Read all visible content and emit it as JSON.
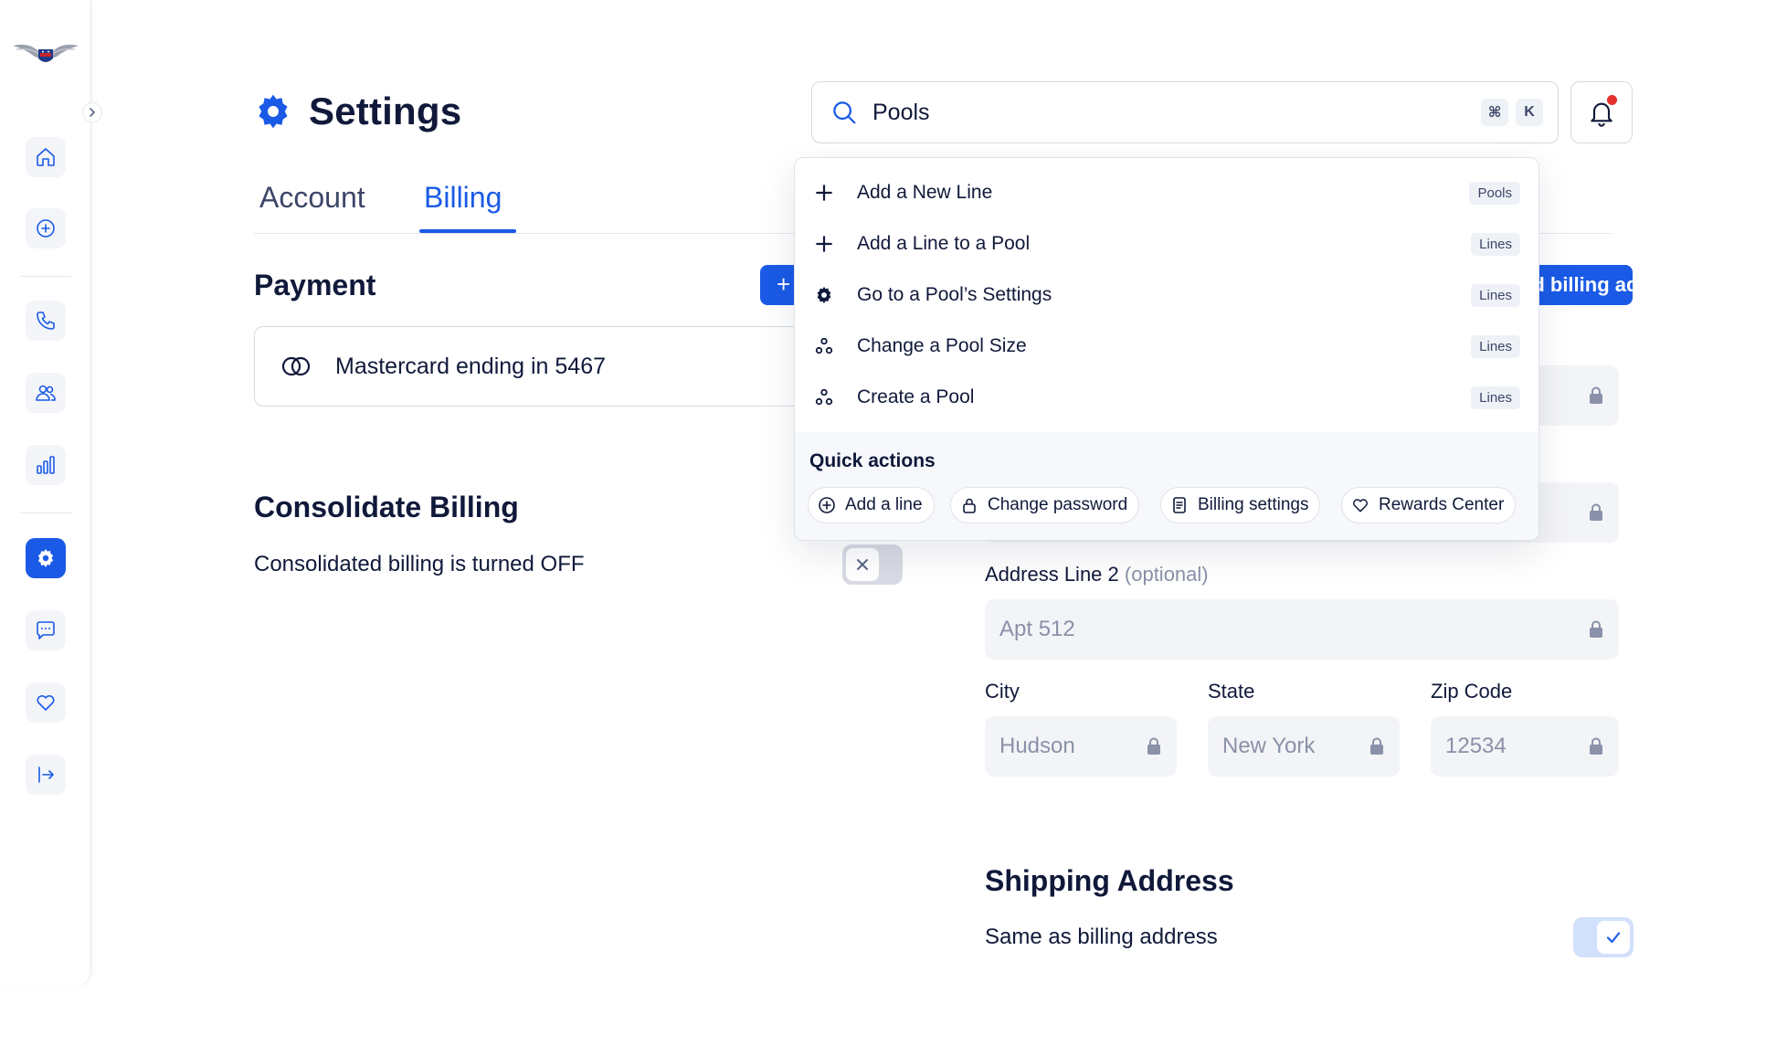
{
  "page": {
    "title": "Settings"
  },
  "search": {
    "value": "Pools",
    "kbd_cmd": "⌘",
    "kbd_key": "K"
  },
  "tabs": {
    "account": "Account",
    "billing": "Billing"
  },
  "payment": {
    "title": "Payment",
    "add_button": "+",
    "card_text": "Mastercard ending in 5467"
  },
  "consolidate": {
    "title": "Consolidate Billing",
    "text": "Consolidated billing is turned OFF"
  },
  "billing_address": {
    "add_button": "Add billing address",
    "address_line_2_label": "Address Line 2",
    "address_line_2_optional": "(optional)",
    "address_line_2_value": "Apt 512",
    "city_label": "City",
    "city_value": "Hudson",
    "state_label": "State",
    "state_value": "New York",
    "zip_label": "Zip Code",
    "zip_value": "12534"
  },
  "shipping": {
    "title": "Shipping Address",
    "text": "Same as billing address"
  },
  "dropdown": {
    "items": [
      {
        "label": "Add a New Line",
        "tag": "Pools",
        "icon": "plus-icon"
      },
      {
        "label": "Add a Line to a Pool",
        "tag": "Lines",
        "icon": "plus-icon"
      },
      {
        "label": "Go to a Pool’s Settings",
        "tag": "Lines",
        "icon": "gear-icon"
      },
      {
        "label": "Change a Pool Size",
        "tag": "Lines",
        "icon": "pool-icon"
      },
      {
        "label": "Create a Pool",
        "tag": "Lines",
        "icon": "pool-icon"
      }
    ],
    "quick_actions_title": "Quick actions",
    "quick_actions": [
      {
        "label": "Add a line",
        "icon": "plus-circle-icon"
      },
      {
        "label": "Change password",
        "icon": "lock-icon"
      },
      {
        "label": "Billing settings",
        "icon": "document-icon"
      },
      {
        "label": "Rewards Center",
        "icon": "heart-icon"
      }
    ]
  },
  "colors": {
    "accent": "#1a5ae6",
    "text": "#10193a",
    "muted": "#8a91a8",
    "notification": "#e5322d"
  }
}
